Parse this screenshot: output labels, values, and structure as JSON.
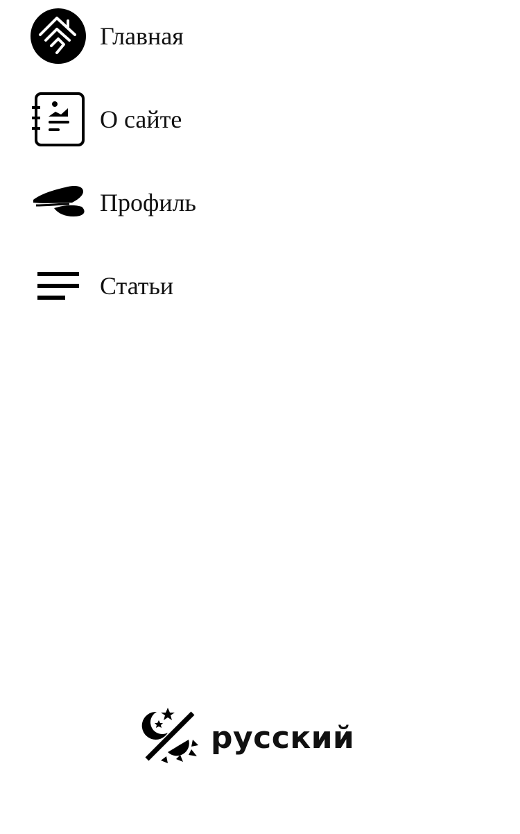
{
  "nav": {
    "items": [
      {
        "label": "Главная",
        "icon": "home-icon"
      },
      {
        "label": "О сайте",
        "icon": "about-notebook-icon"
      },
      {
        "label": "Профиль",
        "icon": "captain-cap-icon"
      },
      {
        "label": "Статьи",
        "icon": "articles-lines-icon"
      }
    ]
  },
  "footer": {
    "theme_toggle_icon": "theme-toggle-icon",
    "language_label": "русский"
  },
  "colors": {
    "text": "#111111",
    "background": "#ffffff"
  }
}
